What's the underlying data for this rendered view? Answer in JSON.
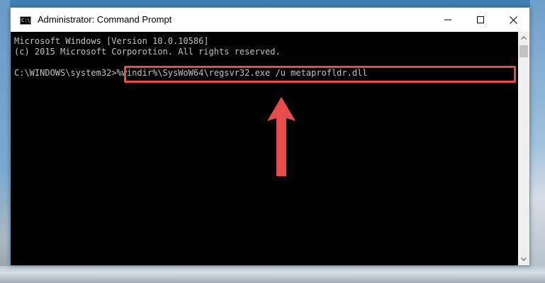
{
  "window": {
    "title": "Administrator: Command Prompt",
    "icon": "cmd-icon",
    "icon_text": "C:\\",
    "buttons": {
      "minimize_icon": "minimize-icon",
      "maximize_icon": "maximize-icon",
      "close_icon": "close-icon"
    }
  },
  "console": {
    "lines": [
      "Microsoft Windows [Version 10.0.10586]",
      "(c) 2015 Microsoft Corporotion. All rights reserved."
    ],
    "prompt": "C:\\WINDOWS\\system32>",
    "command": "%windir%\\SysWoW64\\regsvr32.exe /u metaprofldr.dll",
    "text_color": "#c0c0c0",
    "background": "#000000"
  },
  "annotation": {
    "highlight_color": "#e74c4c",
    "arrow_icon": "up-arrow-icon"
  }
}
